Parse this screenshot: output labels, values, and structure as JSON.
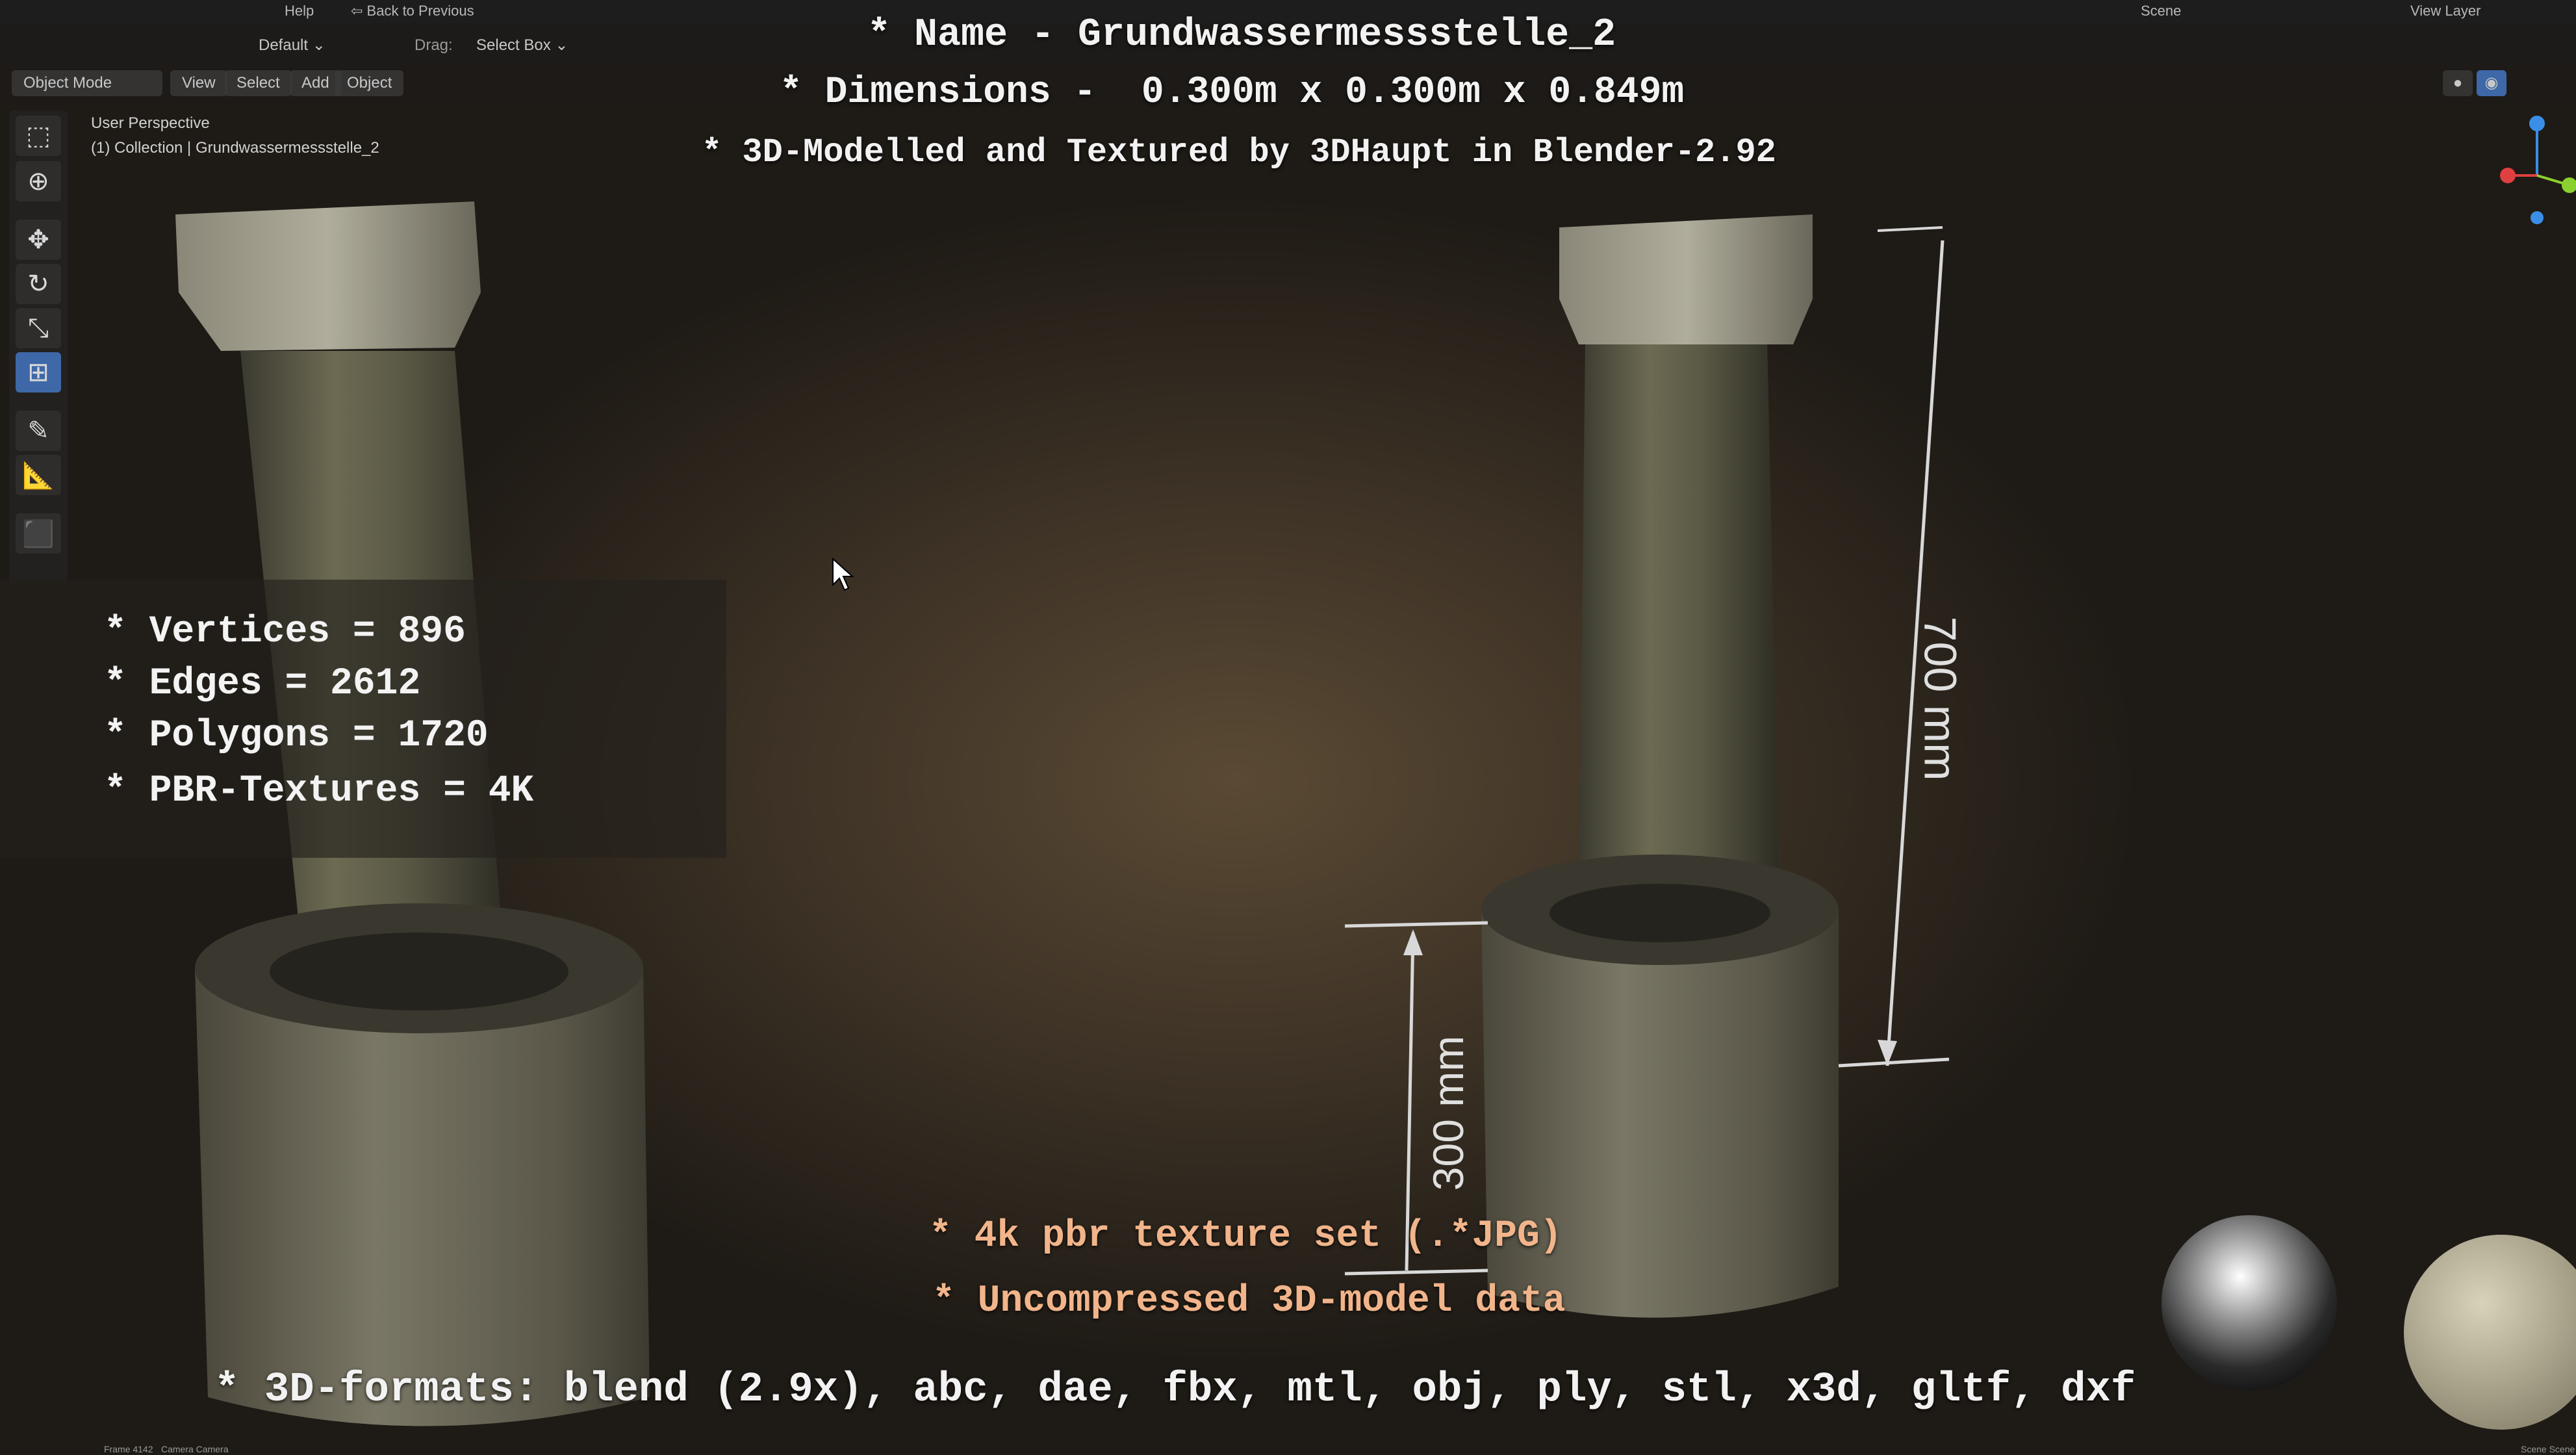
{
  "topbar": {
    "help_menu": "Help",
    "back_button": "Back to Previous",
    "scene_label": "Scene",
    "view_layer_label": "View Layer"
  },
  "toolbar": {
    "orientation": "Default",
    "drag_label": "Drag:",
    "drag_value": "Select Box"
  },
  "header": {
    "mode": "Object Mode",
    "menus": [
      "View",
      "Select",
      "Add",
      "Object"
    ]
  },
  "viewport": {
    "perspective_label": "User Perspective",
    "collection_label": "(1) Collection | Grundwassermessstelle_2"
  },
  "overlay": {
    "name_line": "* Name - Grundwassermessstelle_2",
    "dimensions_line": "* Dimensions -  0.300m x 0.300m x 0.849m",
    "credit_line": "* 3D-Modelled and Textured by 3DHaupt in Blender-2.92",
    "stats": [
      "* Vertices = 896",
      "* Edges = 2612",
      "* Polygons = 1720",
      "* PBR-Textures = 4K"
    ],
    "texture_line": "* 4k pbr texture set (.*JPG)",
    "uncompressed_line": "* Uncompressed 3D-model data",
    "formats_line": "* 3D-formats: blend (2.9x), abc, dae, fbx, mtl, obj, ply, stl, x3d, gltf, dxf"
  },
  "dimension_labels": {
    "height_total": "700 mm",
    "height_base": "300 mm"
  },
  "status": {
    "frame": "Frame 4142",
    "camera": "Camera Camera",
    "scene": "Scene Scene"
  },
  "colors": {
    "accent_blue": "#3e68a8",
    "overlay_orange": "#f2b48a",
    "gizmo_x": "#e04040",
    "gizmo_y": "#8ad030",
    "gizmo_z": "#3a8ee8"
  }
}
